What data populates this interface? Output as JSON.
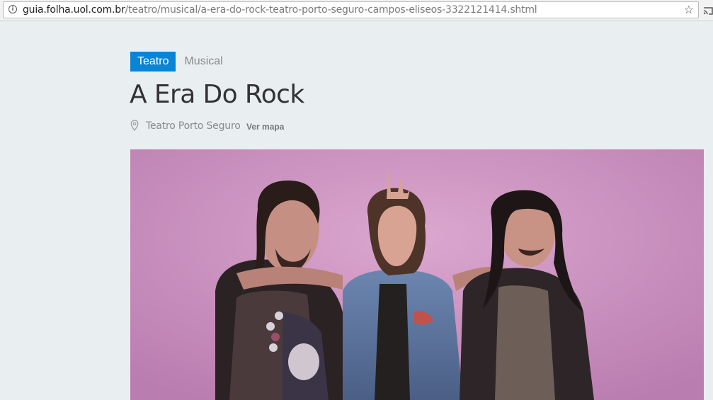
{
  "browser": {
    "url_host": "guia.folha.uol.com.br",
    "url_path": "/teatro/musical/a-era-do-rock-teatro-porto-seguro-campos-eliseos-3322121414.shtml",
    "info_icon": "info-icon",
    "bookmark_icon": "star-icon",
    "cast_icon": "cast-icon"
  },
  "event": {
    "tags": [
      "Teatro",
      "Musical"
    ],
    "title": "A Era Do Rock",
    "venue": "Teatro Porto Seguro",
    "map_link": "Ver mapa",
    "venue_icon": "map-pin-icon"
  },
  "colors": {
    "tag_primary": "#0a85d6",
    "page_background": "#e9eef1",
    "photo_background": "#c98fbf"
  }
}
